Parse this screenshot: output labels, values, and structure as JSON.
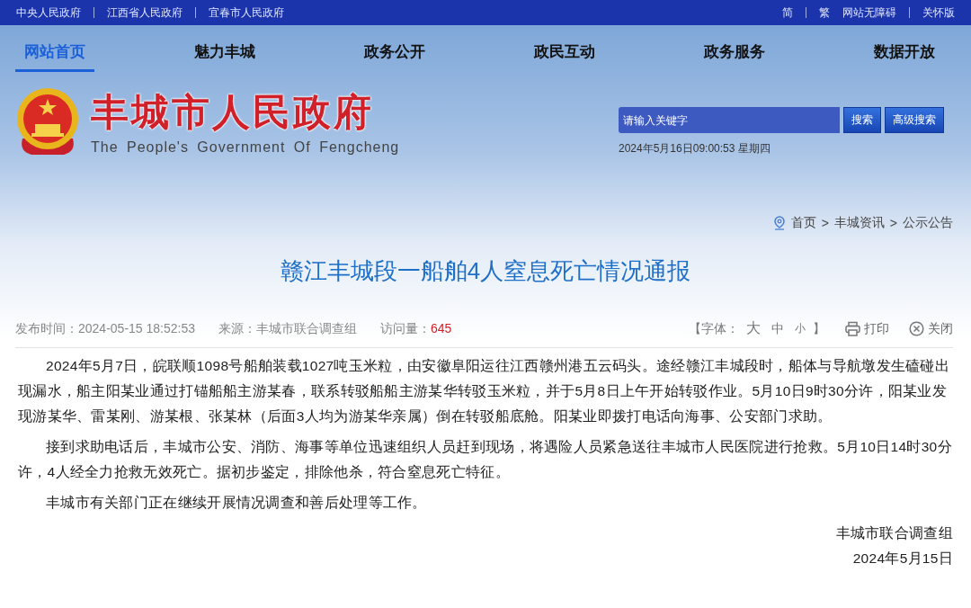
{
  "top_links": [
    "中央人民政府",
    "江西省人民政府",
    "宜春市人民政府"
  ],
  "top_right": [
    "简",
    "繁",
    "网站无障碍",
    "关怀版"
  ],
  "nav": [
    {
      "label": "网站首页",
      "selected": true
    },
    {
      "label": "魅力丰城",
      "selected": false
    },
    {
      "label": "政务公开",
      "selected": false
    },
    {
      "label": "政民互动",
      "selected": false
    },
    {
      "label": "政务服务",
      "selected": false
    },
    {
      "label": "数据开放",
      "selected": false
    }
  ],
  "site": {
    "title": "丰城市人民政府",
    "subtitle": "The People's Government Of Fengcheng"
  },
  "search": {
    "placeholder": "请输入关键字",
    "buttons": [
      "搜索",
      "高级搜索"
    ],
    "datetime": "2024年5月16日09:00:53 星期四"
  },
  "breadcrumb": [
    "首页",
    "丰城资讯",
    "公示公告"
  ],
  "breadcrumb_separator": ">",
  "article": {
    "title": "赣江丰城段一船舶4人窒息死亡情况通报",
    "meta": [
      {
        "label": "发布时间：",
        "value": "2024-05-15 18:52:53",
        "highlight": false
      },
      {
        "label": "来源：",
        "value": "丰城市联合调查组",
        "highlight": false
      },
      {
        "label": "访问量：",
        "value": "645",
        "highlight": true
      }
    ],
    "font_label": "【字体：",
    "font_sizes": [
      "大",
      "中",
      "小"
    ],
    "font_close": "】",
    "print": "打印",
    "close": "关闭",
    "paragraphs": [
      "2024年5月7日，皖联顺1098号船舶装载1027吨玉米粒，由安徽阜阳运往江西赣州港五云码头。途经赣江丰城段时，船体与导航墩发生磕碰出现漏水，船主阳某业通过打锚船船主游某春，联系转驳船船主游某华转驳玉米粒，并于5月8日上午开始转驳作业。5月10日9时30分许，阳某业发现游某华、雷某刚、游某根、张某林（后面3人均为游某华亲属）倒在转驳船底舱。阳某业即拨打电话向海事、公安部门求助。",
      "接到求助电话后，丰城市公安、消防、海事等单位迅速组织人员赶到现场，将遇险人员紧急送往丰城市人民医院进行抢救。5月10日14时30分许，4人经全力抢救无效死亡。据初步鉴定，排除他杀，符合窒息死亡特征。",
      "丰城市有关部门正在继续开展情况调查和善后处理等工作。"
    ],
    "signature": "丰城市联合调查组",
    "date": "2024年5月15日"
  }
}
